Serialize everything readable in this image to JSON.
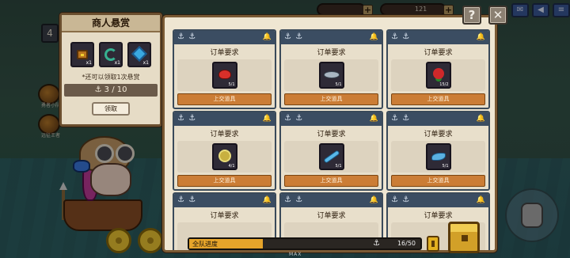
{
  "hud": {
    "coin_value": "",
    "gem_value": "121"
  },
  "left_hud": {
    "level_badge": "4",
    "icon_labels": [
      "勇者小队",
      "远征王者"
    ]
  },
  "bounty": {
    "title": "商人悬赏",
    "items": [
      {
        "icon": "treasure-chest-icon",
        "count": "x1"
      },
      {
        "icon": "green-scroll-icon",
        "count": "x1"
      },
      {
        "icon": "blue-gem-icon",
        "count": "x1"
      }
    ],
    "note": "*还可以领取1次悬赏",
    "progress_current": "3",
    "progress_total": "10",
    "progress_text": "⚓ 3 / 10",
    "claim_label": "领取"
  },
  "orders": {
    "card_title": "订单要求",
    "submit_label": "上交道具",
    "cards": [
      {
        "title": "订单要求",
        "item": "red-crab-icon",
        "count": "5/1",
        "submit": "上交道具"
      },
      {
        "title": "订单要求",
        "item": "silver-fish-icon",
        "count": "5/1",
        "submit": "上交道具"
      },
      {
        "title": "订单要求",
        "item": "red-flower-icon",
        "count": "15/2",
        "submit": "上交道具"
      },
      {
        "title": "订单要求",
        "item": "sea-urchin-icon",
        "count": "4/1",
        "submit": "上交道具"
      },
      {
        "title": "订单要求",
        "item": "blue-sword-fish-icon",
        "count": "5/1",
        "submit": "上交道具"
      },
      {
        "title": "订单要求",
        "item": "blue-fin-icon",
        "count": "5/1",
        "submit": "上交道具"
      },
      {
        "title": "订单要求"
      },
      {
        "title": "订单要求"
      },
      {
        "title": "订单要求"
      }
    ]
  },
  "team_progress": {
    "label": "全队进度",
    "current": 16,
    "total": 50,
    "text": "16/50"
  },
  "buttons": {
    "help": "?",
    "close": "✕"
  },
  "bottom_text": "MAX",
  "colors": {
    "order_header": "#3b4d62",
    "submit_button": "#cb7d36",
    "progress_fill": "#e6a42a",
    "panel_border": "#7a5a34"
  }
}
